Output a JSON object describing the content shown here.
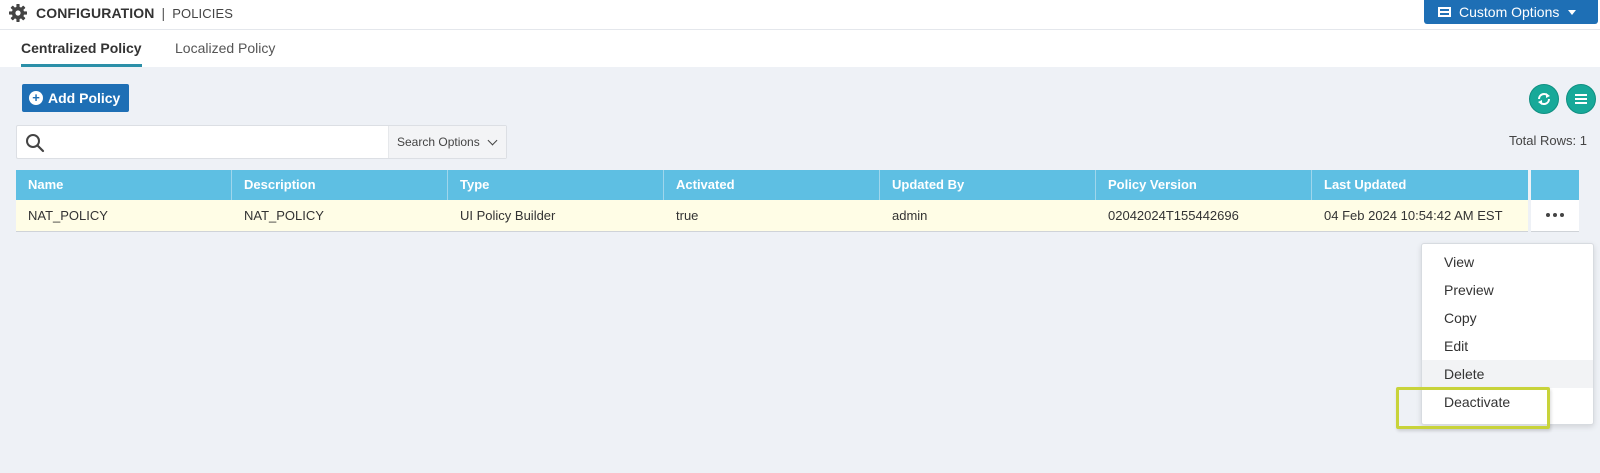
{
  "header": {
    "title": "CONFIGURATION",
    "separator": "|",
    "subtitle": "POLICIES",
    "custom_options_label": "Custom Options"
  },
  "tabs": [
    {
      "label": "Centralized Policy",
      "active": true
    },
    {
      "label": "Localized Policy",
      "active": false
    }
  ],
  "toolbar": {
    "add_policy_label": "Add Policy",
    "add_icon": "plus-circle-icon",
    "refresh_icon": "refresh-icon",
    "list_icon": "list-icon",
    "accent_color": "#17a999"
  },
  "search": {
    "value": "",
    "placeholder": "",
    "options_label": "Search Options"
  },
  "total_rows": "Total Rows: 1",
  "table": {
    "header_color": "#5ebfe3",
    "columns": [
      "Name",
      "Description",
      "Type",
      "Activated",
      "Updated By",
      "Policy Version",
      "Last Updated"
    ],
    "rows": [
      [
        "NAT_POLICY",
        "NAT_POLICY",
        "UI Policy Builder",
        "true",
        "admin",
        "02042024T155442696",
        "04 Feb 2024 10:54:42 AM EST"
      ]
    ]
  },
  "context_menu": {
    "items": [
      "View",
      "Preview",
      "Copy",
      "Edit",
      "Delete",
      "Deactivate"
    ],
    "hovered": "Delete",
    "highlighted": "Deactivate",
    "highlight_color": "#c8d33a"
  }
}
